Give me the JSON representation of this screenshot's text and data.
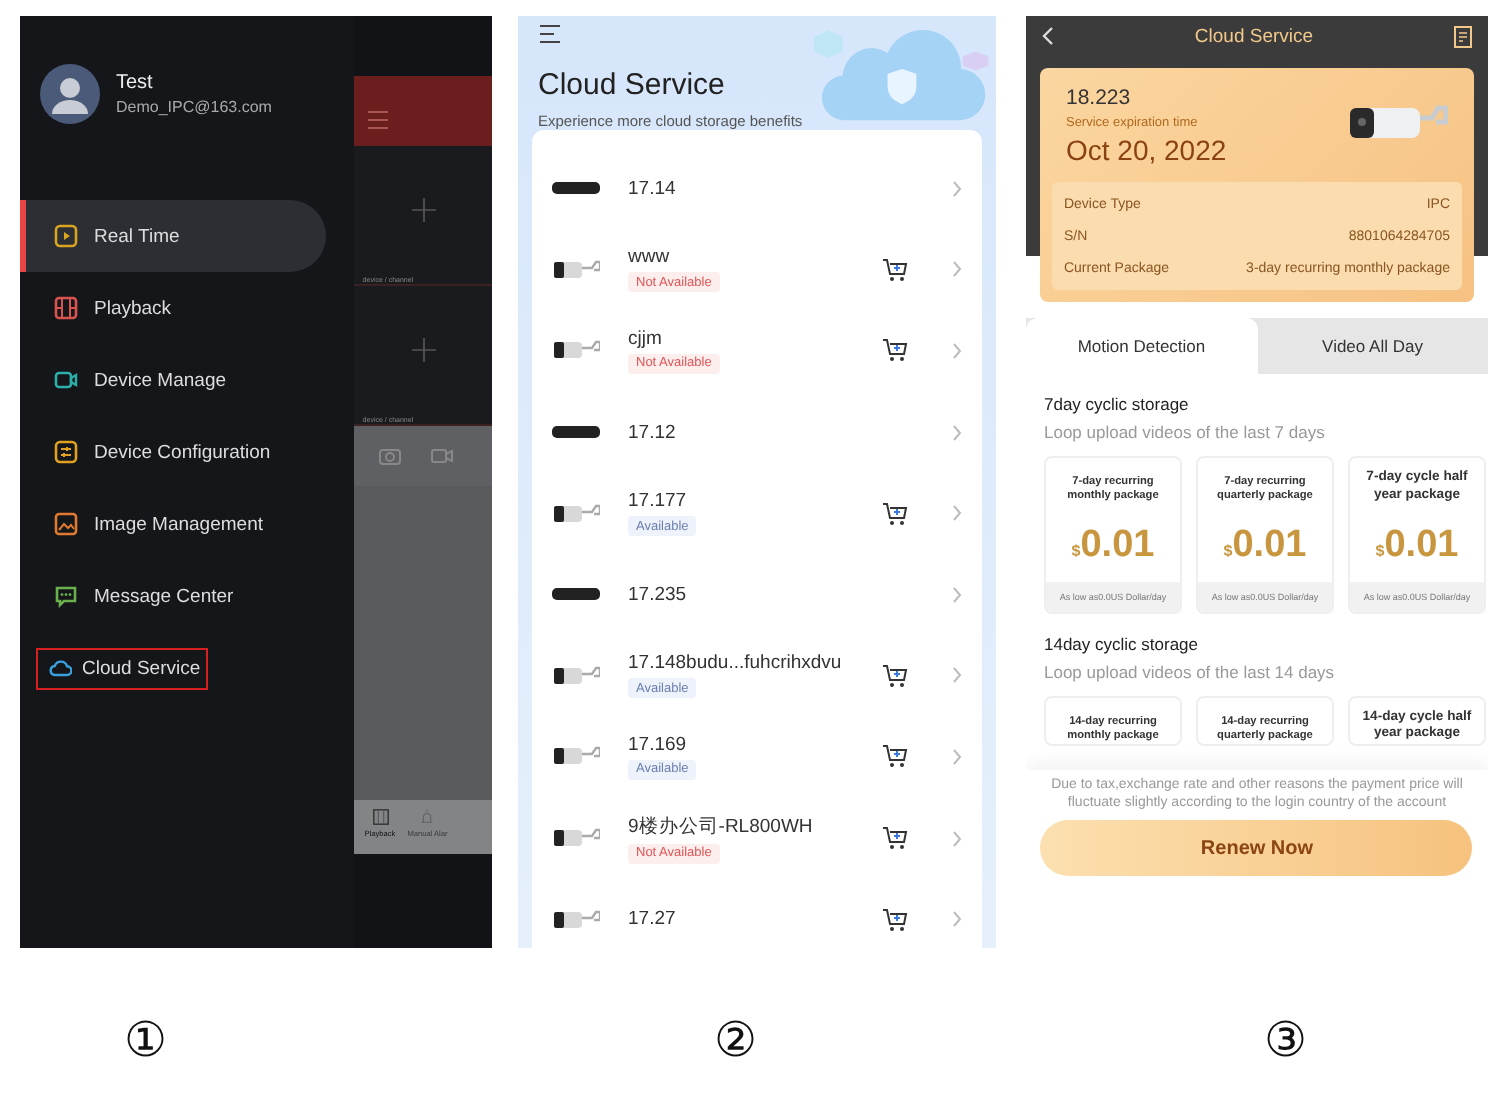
{
  "drawer_screen": {
    "user": {
      "name": "Test",
      "email": "Demo_IPC@163.com"
    },
    "menu_items": [
      {
        "label": "Real Time",
        "selected": true,
        "highlighted": false
      },
      {
        "label": "Playback",
        "selected": false,
        "highlighted": false
      },
      {
        "label": "Device Manage",
        "selected": false,
        "highlighted": false
      },
      {
        "label": "Device Configuration",
        "selected": false,
        "highlighted": false
      },
      {
        "label": "Image Management",
        "selected": false,
        "highlighted": false
      },
      {
        "label": "Message Center",
        "selected": false,
        "highlighted": false
      },
      {
        "label": "Cloud Service",
        "selected": false,
        "highlighted": true
      }
    ],
    "background_app": {
      "tile_labels": [
        "device / channel",
        "device / channel"
      ],
      "tabs": [
        {
          "label": "Playback",
          "selected": true
        },
        {
          "label": "Manual Alar",
          "selected": false
        }
      ]
    }
  },
  "cloud_service_screen": {
    "title": "Cloud Service",
    "subtitle": "Experience more cloud storage benefits",
    "devices": [
      {
        "kind": "nvr",
        "name": "17.14"
      },
      {
        "kind": "camera",
        "name": "www",
        "status": "Not Available",
        "available": false
      },
      {
        "kind": "camera",
        "name": "cjjm",
        "status": "Not Available",
        "available": false
      },
      {
        "kind": "nvr",
        "name": "17.12"
      },
      {
        "kind": "camera",
        "name": "17.177",
        "status": "Available",
        "available": true
      },
      {
        "kind": "nvr",
        "name": "17.235"
      },
      {
        "kind": "camera",
        "name": "17.148budu...fuhcrihxdvu",
        "status": "Available",
        "available": true
      },
      {
        "kind": "camera",
        "name": "17.169",
        "status": "Available",
        "available": true
      },
      {
        "kind": "camera",
        "name": "9楼办公司-RL800WH",
        "status": "Not Available",
        "available": false
      },
      {
        "kind": "camera",
        "name": "17.27"
      }
    ]
  },
  "cloud_detail_screen": {
    "title": "Cloud Service",
    "device": {
      "name": "18.223",
      "expiration_label": "Service expiration time",
      "expiration_date": "Oct 20, 2022",
      "details": [
        {
          "label": "Device Type",
          "value": "IPC"
        },
        {
          "label": "S/N",
          "value": "8801064284705"
        },
        {
          "label": "Current Package",
          "value": "3-day recurring monthly package"
        }
      ]
    },
    "tabs": [
      {
        "label": "Motion Detection",
        "selected": true
      },
      {
        "label": "Video All Day",
        "selected": false
      }
    ],
    "sections": [
      {
        "title": "7day cyclic storage",
        "subtitle": "Loop upload videos of the last 7 days",
        "packages": [
          {
            "name": "7-day recurring monthly package",
            "currency": "$",
            "price": "0.01",
            "note": "As low as0.0US Dollar/day"
          },
          {
            "name": "7-day recurring quarterly package",
            "currency": "$",
            "price": "0.01",
            "note": "As low as0.0US Dollar/day"
          },
          {
            "name": "7-day cycle half year package",
            "currency": "$",
            "price": "0.01",
            "note": "As low as0.0US Dollar/day"
          }
        ]
      },
      {
        "title": "14day cyclic storage",
        "subtitle": "Loop upload videos of the last 14 days",
        "packages": [
          {
            "name": "14-day recurring monthly package"
          },
          {
            "name": "14-day recurring quarterly package"
          },
          {
            "name": "14-day cycle half year package"
          }
        ]
      }
    ],
    "notice": "Due to tax,exchange rate and other reasons the payment price will fluctuate slightly according to the login country of the account",
    "button": "Renew Now"
  },
  "step_labels": [
    "①",
    "②",
    "③"
  ]
}
